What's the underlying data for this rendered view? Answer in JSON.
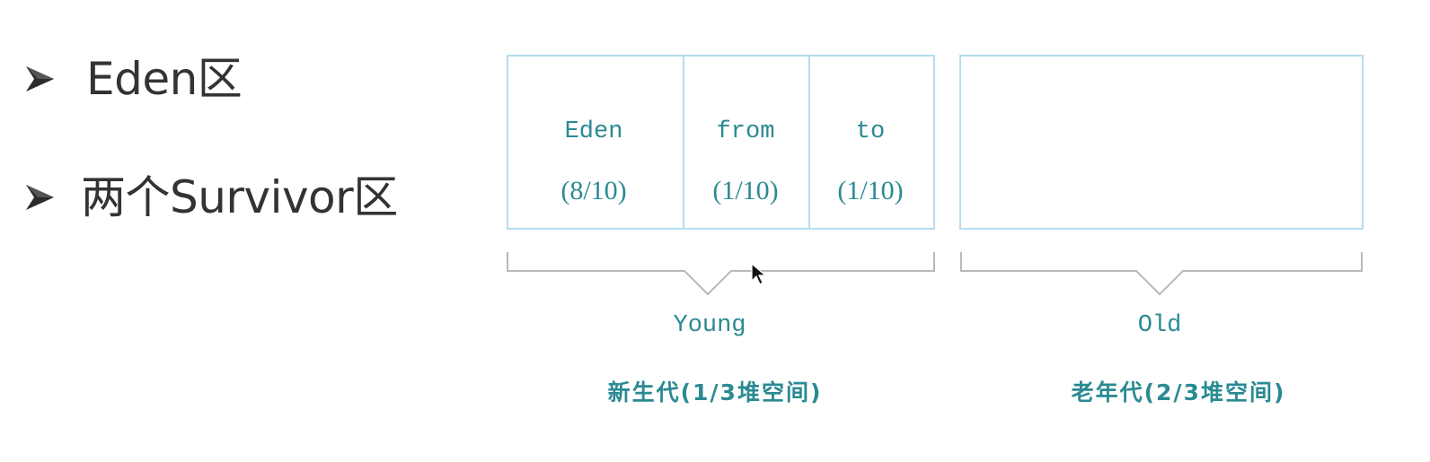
{
  "bullets": [
    {
      "icon": "arrowhead-bullet-icon",
      "text": "Eden区"
    },
    {
      "icon": "arrowhead-bullet-icon",
      "text": "两个Survivor区"
    }
  ],
  "diagram": {
    "cells": [
      {
        "name": "Eden",
        "ratio": "(8/10)"
      },
      {
        "name": "from",
        "ratio": "(1/10)"
      },
      {
        "name": "to",
        "ratio": "(1/10)"
      }
    ],
    "young": {
      "label": "Young",
      "desc": "新生代(1/3堆空间)"
    },
    "old": {
      "label": "Old",
      "desc": "老年代(2/3堆空间)"
    },
    "colors": {
      "box_border": "#b6dcef",
      "text": "#2a8a92",
      "brace": "#b8b8b8",
      "bullet_text": "#333333"
    }
  },
  "cursor": {
    "icon": "mouse-pointer-icon"
  }
}
